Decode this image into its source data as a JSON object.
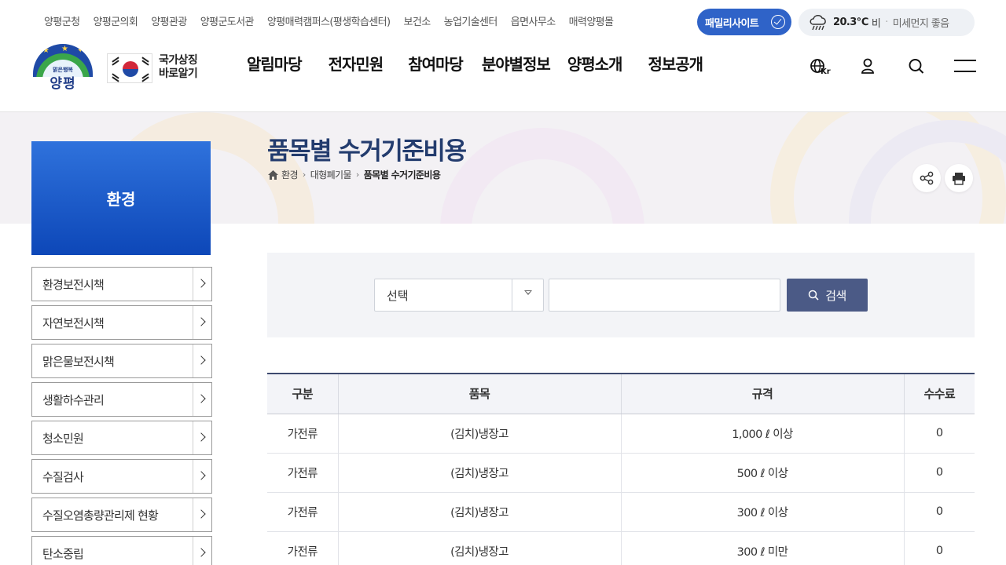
{
  "top_links": [
    "양평군청",
    "양평군의회",
    "양평관광",
    "양평군도서관",
    "양평매력캠퍼스(평생학습센터)",
    "보건소",
    "농업기술센터",
    "읍면사무소",
    "매력양평몰"
  ],
  "family_site": "패밀리사이트",
  "weather": {
    "temp": "20.3℃",
    "condition": "비",
    "separator": "·",
    "dust": "미세먼지 좋음"
  },
  "logo": {
    "tagline": "맑은행복",
    "name": "양평"
  },
  "national_symbol": {
    "line1": "국가상징",
    "line2": "바로알기"
  },
  "gnb": [
    "알림마당",
    "전자민원",
    "참여마당",
    "분야별정보",
    "양평소개",
    "정보공개"
  ],
  "lang_label": "Kr",
  "page": {
    "title": "품목별 수거기준비용",
    "breadcrumb": [
      "환경",
      "대형폐기물",
      "품목별 수거기준비용"
    ]
  },
  "lnb": {
    "title": "환경",
    "items": [
      "환경보전시책",
      "자연보전시책",
      "맑은물보전시책",
      "생활하수관리",
      "청소민원",
      "수질검사",
      "수질오염총량관리제 현황",
      "탄소중립"
    ]
  },
  "search": {
    "select_value": "선택",
    "input_value": "",
    "button_label": "검색"
  },
  "table": {
    "headers": [
      "구분",
      "품목",
      "규격",
      "수수료"
    ],
    "rows": [
      [
        "가전류",
        "(김치)냉장고",
        "1,000 ℓ 이상",
        "0"
      ],
      [
        "가전류",
        "(김치)냉장고",
        "500 ℓ 이상",
        "0"
      ],
      [
        "가전류",
        "(김치)냉장고",
        "300 ℓ 이상",
        "0"
      ],
      [
        "가전류",
        "(김치)냉장고",
        "300 ℓ 미만",
        "0"
      ]
    ]
  },
  "colors": {
    "primary": "#2f63c8",
    "title": "#233c6e",
    "button": "#4b5a86",
    "lnb_top": "#2f72dc",
    "lnb_bottom": "#0d47b8"
  }
}
